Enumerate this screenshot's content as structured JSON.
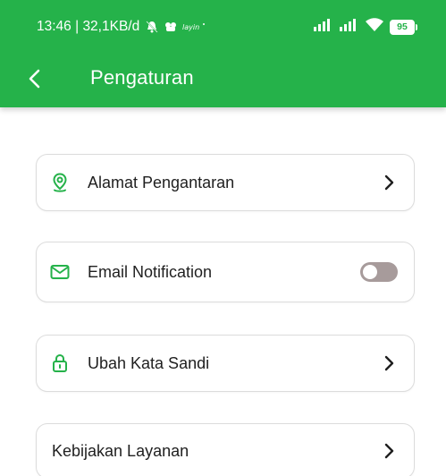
{
  "status_bar": {
    "time": "13:46",
    "network_speed": "32,1KB/d",
    "battery_level": "95",
    "icons": [
      "mute-icon",
      "app-notification-icon",
      "signal-icon",
      "signal-icon",
      "wifi-icon",
      "battery-icon"
    ]
  },
  "appbar": {
    "title": "Pengaturan",
    "back_icon": "chevron-left-icon"
  },
  "colors": {
    "primary": "#25b24a",
    "toggle_off": "#a79b9b",
    "card_border": "#dcdcdc",
    "text": "#1f1f1f"
  },
  "settings": {
    "items": [
      {
        "label": "Alamat Pengantaran",
        "icon": "location-pin-icon",
        "control": "chevron"
      },
      {
        "label": "Email Notification",
        "icon": "mail-icon",
        "control": "toggle",
        "enabled": false
      },
      {
        "label": "Ubah Kata Sandi",
        "icon": "lock-icon",
        "control": "chevron"
      },
      {
        "label": "Kebijakan Layanan",
        "icon": null,
        "control": "chevron"
      }
    ]
  }
}
